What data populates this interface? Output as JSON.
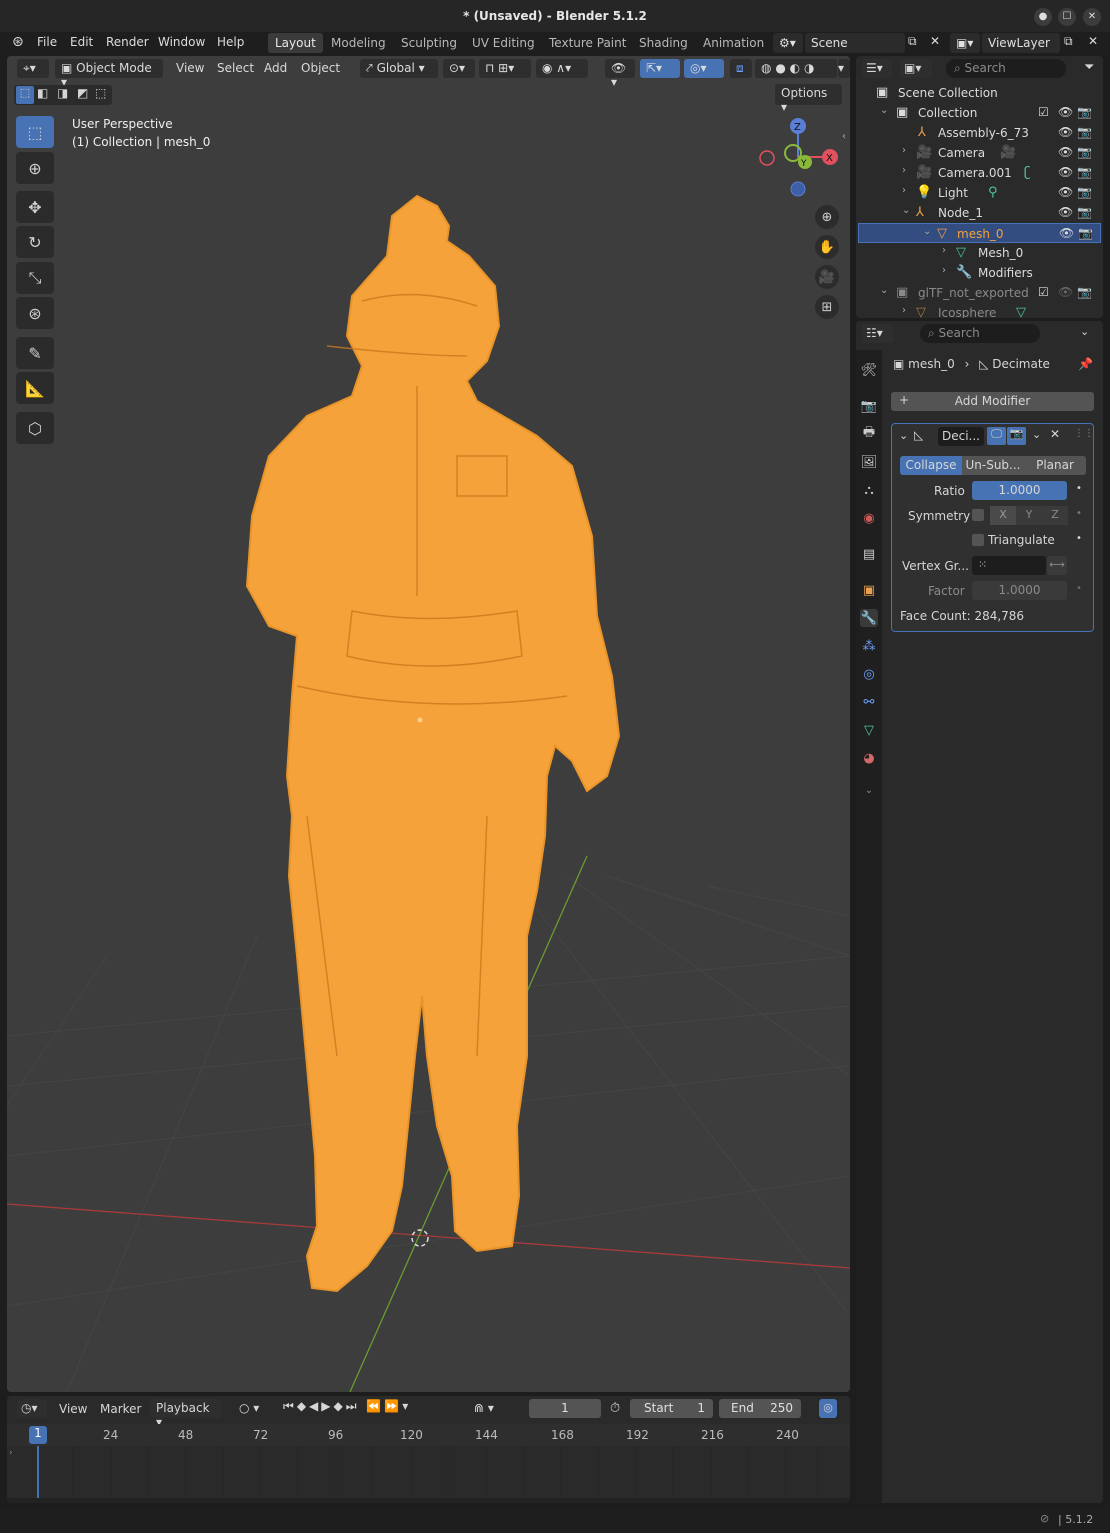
{
  "window": {
    "title": "* (Unsaved) - Blender 5.1.2"
  },
  "menu": {
    "file": "File",
    "edit": "Edit",
    "render": "Render",
    "window": "Window",
    "help": "Help"
  },
  "workspaces": [
    "Layout",
    "Modeling",
    "Sculpting",
    "UV Editing",
    "Texture Paint",
    "Shading",
    "Animation"
  ],
  "scene": {
    "name": "Scene",
    "view_layer": "ViewLayer"
  },
  "viewport": {
    "mode": "Object Mode",
    "menus": [
      "View",
      "Select",
      "Add",
      "Object"
    ],
    "orientation": "Global",
    "options": "Options",
    "info_line1": "User Perspective",
    "info_line2": "(1) Collection | mesh_0",
    "gizmo": {
      "z": "Z",
      "x": "X",
      "y": "Y"
    }
  },
  "outliner": {
    "search_placeholder": "Search",
    "rows": [
      {
        "label": "Scene Collection"
      },
      {
        "label": "Collection"
      },
      {
        "label": "Assembly-6_73"
      },
      {
        "label": "Camera"
      },
      {
        "label": "Camera.001"
      },
      {
        "label": "Light"
      },
      {
        "label": "Node_1"
      },
      {
        "label": "mesh_0"
      },
      {
        "label": "Mesh_0"
      },
      {
        "label": "Modifiers"
      },
      {
        "label": "glTF_not_exported"
      },
      {
        "label": "Icosphere"
      }
    ]
  },
  "properties": {
    "search_placeholder": "Search",
    "breadcrumb_object": "mesh_0",
    "breadcrumb_modifier": "Decimate",
    "add_modifier": "Add Modifier",
    "modifier_name": "Deci...",
    "tabs": [
      "Collapse",
      "Un-Sub...",
      "Planar"
    ],
    "ratio_label": "Ratio",
    "ratio_value": "1.0000",
    "symmetry_label": "Symmetry",
    "axes": [
      "X",
      "Y",
      "Z"
    ],
    "triangulate_label": "Triangulate",
    "vertex_group_label": "Vertex Gr...",
    "factor_label": "Factor",
    "factor_value": "1.0000",
    "face_count": "Face Count: 284,786"
  },
  "timeline": {
    "menus": [
      "View",
      "Marker",
      "Playback"
    ],
    "current_frame": "1",
    "start_label": "Start",
    "start_value": "1",
    "end_label": "End",
    "end_value": "250",
    "ruler": [
      "1",
      "24",
      "48",
      "72",
      "96",
      "120",
      "144",
      "168",
      "192",
      "216",
      "240"
    ]
  },
  "status": {
    "version": "5.1.2"
  },
  "colors": {
    "accent": "#4772b3",
    "selection": "#f5a23a",
    "bg_viewport": "#3d3d3d"
  }
}
